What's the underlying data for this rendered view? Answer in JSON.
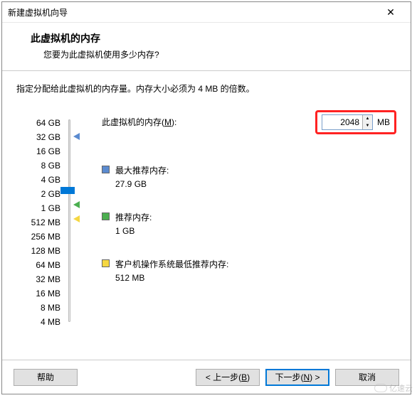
{
  "window": {
    "title": "新建虚拟机向导"
  },
  "header": {
    "title": "此虚拟机的内存",
    "subtitle": "您要为此虚拟机使用多少内存?"
  },
  "instruction": "指定分配给此虚拟机的内存量。内存大小必须为 4 MB 的倍数。",
  "scale": [
    "64 GB",
    "32 GB",
    "16 GB",
    "8 GB",
    "4 GB",
    "2 GB",
    "1 GB",
    "512 MB",
    "256 MB",
    "128 MB",
    "64 MB",
    "32 MB",
    "16 MB",
    "8 MB",
    "4 MB"
  ],
  "memory_label_prefix": "此虚拟机的内存(",
  "memory_label_key": "M",
  "memory_label_suffix": "):",
  "memory_value": "2048",
  "memory_unit": "MB",
  "recommendations": {
    "max": {
      "label": "最大推荐内存:",
      "value": "27.9 GB",
      "color": "#5b8bd0"
    },
    "rec": {
      "label": "推荐内存:",
      "value": "1 GB",
      "color": "#4caf50"
    },
    "min": {
      "label": "客户机操作系统最低推荐内存:",
      "value": "512 MB",
      "color": "#f5d742"
    }
  },
  "buttons": {
    "help": "帮助",
    "back_prefix": "< 上一步(",
    "back_key": "B",
    "back_suffix": ")",
    "next_prefix": "下一步(",
    "next_key": "N",
    "next_suffix": ") >",
    "cancel": "取消"
  },
  "watermark": "亿速云"
}
